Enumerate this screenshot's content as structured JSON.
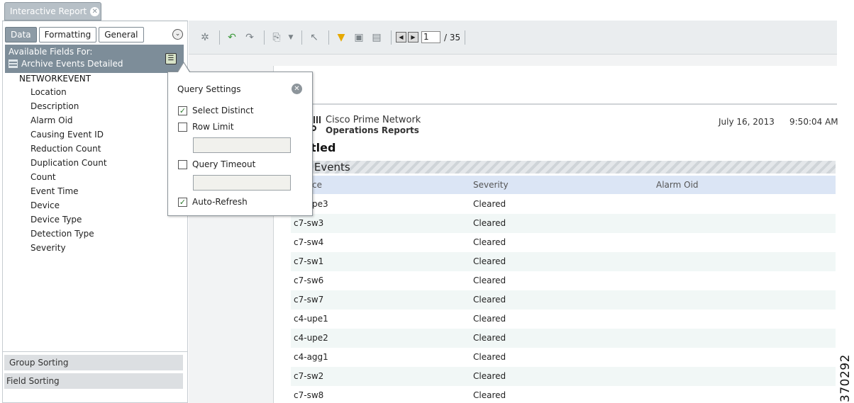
{
  "tab": {
    "title": "Interactive Report"
  },
  "left_panel": {
    "tabs": [
      "Data",
      "Formatting",
      "General"
    ],
    "available_label": "Available Fields For:",
    "dataset_name": "Archive Events Detailed",
    "root_node": "NETWORKEVENT",
    "fields": [
      "Location",
      "Description",
      "Alarm Oid",
      "Causing Event ID",
      "Reduction Count",
      "Duplication Count",
      "Count",
      "Event Time",
      "Device",
      "Device Type",
      "Detection Type",
      "Severity"
    ],
    "group_sorting": "Group Sorting",
    "field_sorting": "Field Sorting"
  },
  "toolbar": {
    "page_current": "1",
    "page_total": "/ 35"
  },
  "report": {
    "brand_name": "Cisco Prime Network",
    "brand_sub": "Operations Reports",
    "date": "July 16, 2013",
    "time": "9:50:04 AM",
    "title": "tled",
    "section": "ve Events",
    "columns": [
      "ce",
      "Severity",
      "Alarm Oid"
    ],
    "rows": [
      {
        "device": "pe3",
        "severity": "Cleared"
      },
      {
        "device": "c7-sw3",
        "severity": "Cleared"
      },
      {
        "device": "c7-sw4",
        "severity": "Cleared"
      },
      {
        "device": "c7-sw1",
        "severity": "Cleared"
      },
      {
        "device": "c7-sw6",
        "severity": "Cleared"
      },
      {
        "device": "c7-sw7",
        "severity": "Cleared"
      },
      {
        "device": "c4-upe1",
        "severity": "Cleared"
      },
      {
        "device": "c4-upe2",
        "severity": "Cleared"
      },
      {
        "device": "c4-agg1",
        "severity": "Cleared"
      },
      {
        "device": "c7-sw2",
        "severity": "Cleared"
      },
      {
        "device": "c7-sw8",
        "severity": "Cleared"
      }
    ]
  },
  "query_settings": {
    "title": "Query Settings",
    "select_distinct": {
      "label": "Select Distinct",
      "checked": true
    },
    "row_limit": {
      "label": "Row Limit",
      "checked": false,
      "value": ""
    },
    "query_timeout": {
      "label": "Query Timeout",
      "checked": false,
      "value": ""
    },
    "auto_refresh": {
      "label": "Auto-Refresh",
      "checked": true
    }
  },
  "figure_number": "370292",
  "icons": [
    "close-icon",
    "collapse-icon",
    "table-icon",
    "menu-icon",
    "refresh-icon",
    "undo-icon",
    "redo-icon",
    "export-icon",
    "dropdown-arrow-icon",
    "select-cursor-icon",
    "filter-icon",
    "layout-icon",
    "page-setup-icon",
    "first-page-icon",
    "next-page-icon",
    "checkmark-icon"
  ]
}
